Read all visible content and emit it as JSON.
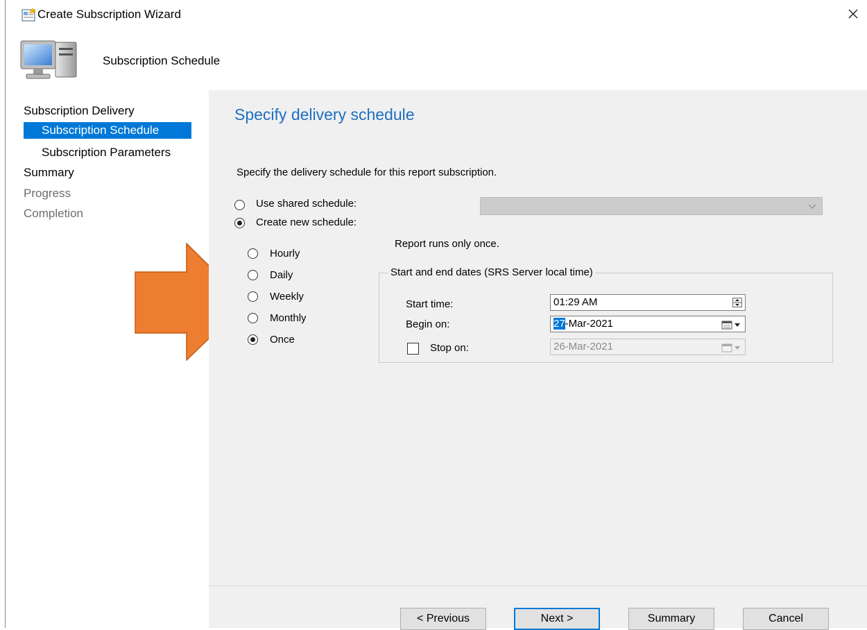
{
  "window": {
    "title": "Create Subscription Wizard"
  },
  "header": {
    "subtitle": "Subscription Schedule"
  },
  "nav": {
    "items": [
      {
        "label": "Subscription Delivery"
      },
      {
        "label": "Subscription Schedule"
      },
      {
        "label": "Subscription Parameters"
      },
      {
        "label": "Summary"
      },
      {
        "label": "Progress"
      },
      {
        "label": "Completion"
      }
    ]
  },
  "main": {
    "heading": "Specify delivery schedule",
    "description": "Specify the delivery schedule for this report subscription.",
    "shared_schedule": {
      "label": "Use shared schedule:",
      "value": ""
    },
    "new_schedule": {
      "label": "Create new schedule:"
    },
    "frequency": {
      "options": [
        {
          "label": "Hourly"
        },
        {
          "label": "Daily"
        },
        {
          "label": "Weekly"
        },
        {
          "label": "Monthly"
        },
        {
          "label": "Once"
        }
      ],
      "selected": "Once"
    },
    "run_note": "Report runs only once.",
    "dates": {
      "group_title": "Start and end dates (SRS Server local time)",
      "start_time_label": "Start time:",
      "start_time_value": "01:29 AM",
      "begin_on_label": "Begin on:",
      "begin_on_day": "27",
      "begin_on_rest": "-Mar-2021",
      "stop_on_label": "Stop on:",
      "stop_on_value": "26-Mar-2021",
      "stop_on_checked": false
    }
  },
  "buttons": {
    "previous": "< Previous",
    "next": "Next >",
    "summary": "Summary",
    "cancel": "Cancel"
  },
  "colors": {
    "accent": "#0078d7",
    "heading": "#1e6fc0",
    "annotation_arrow": "#ed7d31"
  }
}
